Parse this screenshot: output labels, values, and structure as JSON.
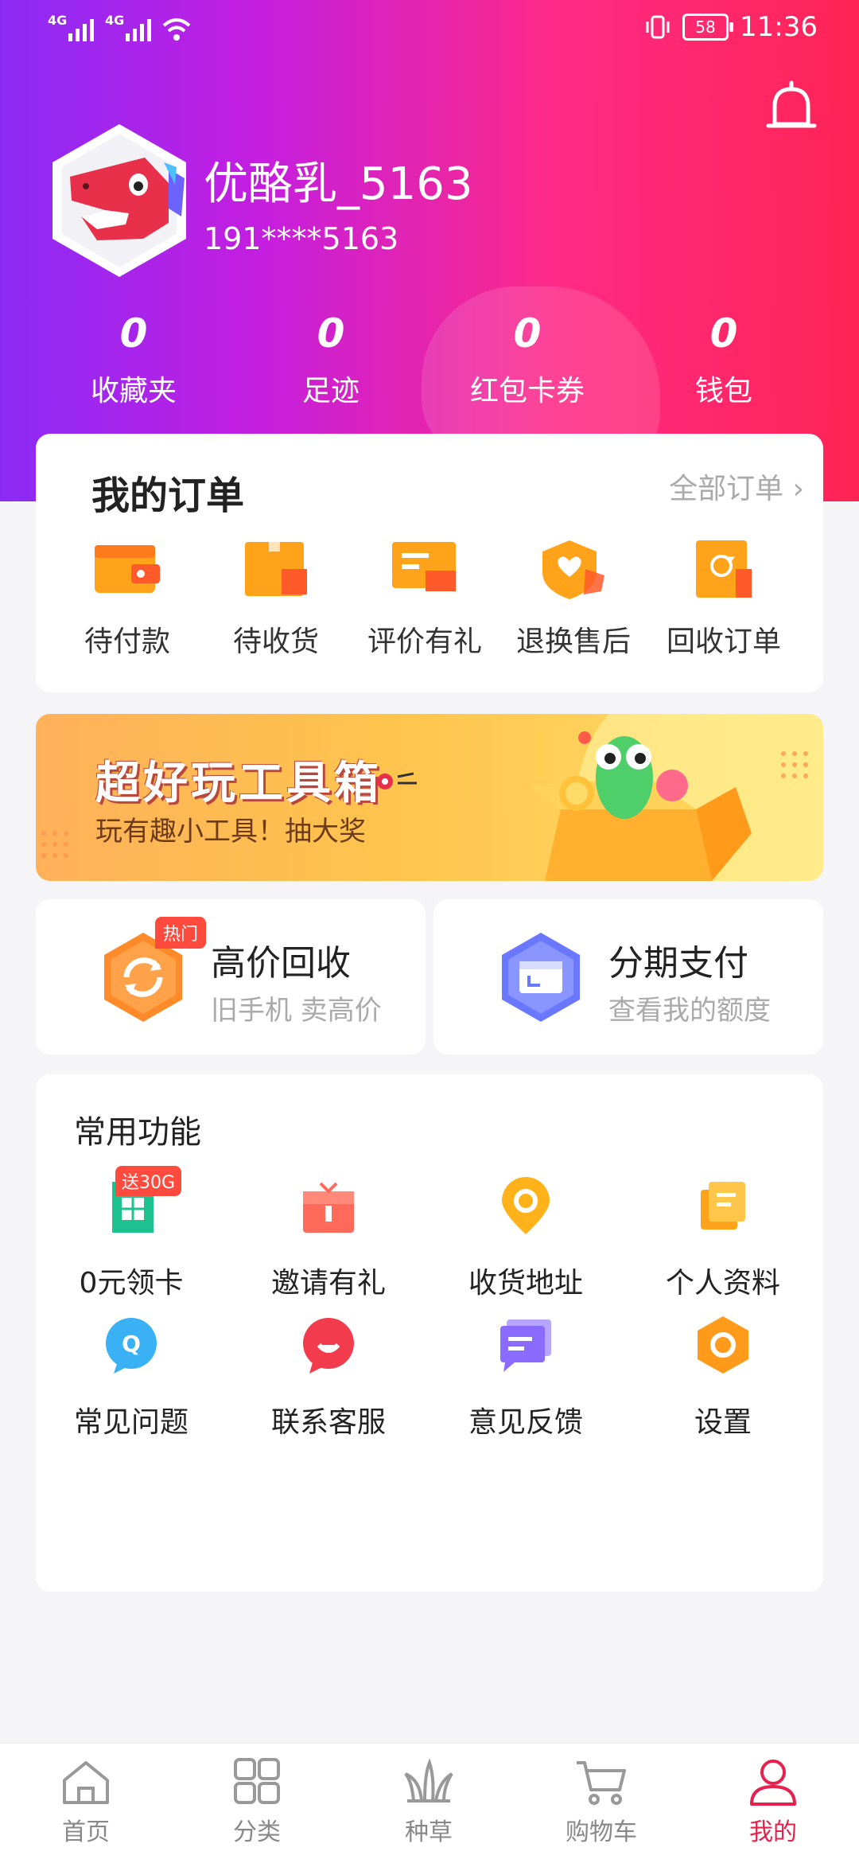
{
  "status_bar": {
    "signal_1": "4G",
    "signal_2": "4G",
    "battery": "58",
    "time": "11:36"
  },
  "profile": {
    "username": "优酪乳_5163",
    "phone": "191****5163"
  },
  "stats": [
    {
      "count": "0",
      "label": "收藏夹"
    },
    {
      "count": "0",
      "label": "足迹"
    },
    {
      "count": "0",
      "label": "红包卡券"
    },
    {
      "count": "0",
      "label": "钱包"
    }
  ],
  "orders": {
    "title": "我的订单",
    "view_all": "全部订单 ›",
    "items": [
      {
        "label": "待付款",
        "icon": "wallet-icon"
      },
      {
        "label": "待收货",
        "icon": "box-icon"
      },
      {
        "label": "评价有礼",
        "icon": "review-icon"
      },
      {
        "label": "退换售后",
        "icon": "shield-heart-icon"
      },
      {
        "label": "回收订单",
        "icon": "recycle-order-icon"
      }
    ]
  },
  "banner": {
    "title": "超好玩工具箱",
    "subtitle": "玩有趣小工具！抽大奖"
  },
  "promos": [
    {
      "title": "高价回收",
      "subtitle": "旧手机 卖高价",
      "badge": "热门"
    },
    {
      "title": "分期支付",
      "subtitle": "查看我的额度"
    }
  ],
  "functions": {
    "title": "常用功能",
    "items": [
      {
        "label": "0元领卡",
        "badge": "送30G",
        "icon": "sim-card-icon"
      },
      {
        "label": "邀请有礼",
        "icon": "gift-icon"
      },
      {
        "label": "收货地址",
        "icon": "location-pin-icon"
      },
      {
        "label": "个人资料",
        "icon": "document-icon"
      },
      {
        "label": "常见问题",
        "icon": "question-bubble-icon"
      },
      {
        "label": "联系客服",
        "icon": "customer-service-icon"
      },
      {
        "label": "意见反馈",
        "icon": "feedback-icon"
      },
      {
        "label": "设置",
        "icon": "settings-icon"
      }
    ]
  },
  "tabbar": [
    {
      "label": "首页",
      "icon": "home-icon"
    },
    {
      "label": "分类",
      "icon": "category-icon"
    },
    {
      "label": "种草",
      "icon": "grass-icon"
    },
    {
      "label": "购物车",
      "icon": "cart-icon"
    },
    {
      "label": "我的",
      "icon": "profile-icon",
      "active": true
    }
  ],
  "colors": {
    "header_gradient_start": "#8a2bf5",
    "header_gradient_end": "#ff2454",
    "accent": "#e5224e",
    "orange_icon": "#ff8a1a"
  }
}
